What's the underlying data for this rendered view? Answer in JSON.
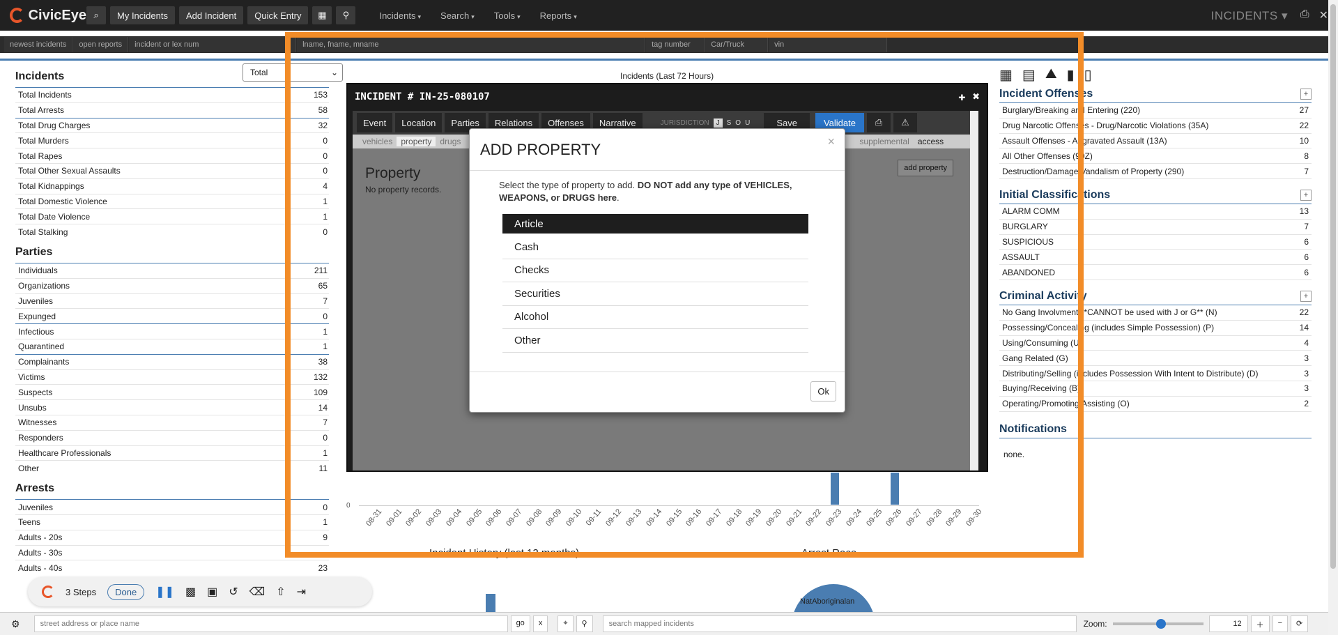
{
  "app": {
    "name": "CivicEye",
    "section_title": "INCIDENTS"
  },
  "topnav": {
    "buttons": [
      "My Incidents",
      "Add Incident",
      "Quick Entry"
    ],
    "menus": [
      "Incidents",
      "Search",
      "Tools",
      "Reports"
    ]
  },
  "subbar": {
    "fields": [
      "newest incidents",
      "open reports",
      "incident or lex num",
      "lname, fname, mname",
      "tag number",
      "Car/Truck",
      "vin"
    ]
  },
  "incidents": {
    "title": "Incidents",
    "filter": "Total",
    "rows": [
      [
        "Total Incidents",
        "153"
      ],
      [
        "Total Arrests",
        "58"
      ],
      [
        "Total Drug Charges",
        "32"
      ],
      [
        "Total Murders",
        "0"
      ],
      [
        "Total Rapes",
        "0"
      ],
      [
        "Total Other Sexual Assaults",
        "0"
      ],
      [
        "Total Kidnappings",
        "4"
      ],
      [
        "Total Domestic Violence",
        "1"
      ],
      [
        "Total Date Violence",
        "1"
      ],
      [
        "Total Stalking",
        "0"
      ]
    ]
  },
  "parties": {
    "title": "Parties",
    "rows": [
      [
        "Individuals",
        "211"
      ],
      [
        "Organizations",
        "65"
      ],
      [
        "Juveniles",
        "7"
      ],
      [
        "Expunged",
        "0"
      ],
      [
        "Infectious",
        "1"
      ],
      [
        "Quarantined",
        "1"
      ],
      [
        "Complainants",
        "38"
      ],
      [
        "Victims",
        "132"
      ],
      [
        "Suspects",
        "109"
      ],
      [
        "Unsubs",
        "14"
      ],
      [
        "Witnesses",
        "7"
      ],
      [
        "Responders",
        "0"
      ],
      [
        "Healthcare Professionals",
        "1"
      ],
      [
        "Other",
        "11"
      ]
    ]
  },
  "arrests": {
    "title": "Arrests",
    "rows": [
      [
        "Juveniles",
        "0"
      ],
      [
        "Teens",
        "1"
      ],
      [
        "Adults - 20s",
        "9"
      ],
      [
        "Adults - 30s",
        ""
      ],
      [
        "Adults - 40s",
        "23"
      ]
    ]
  },
  "chart": {
    "title": "Incidents (Last 72 Hours)",
    "zero": "0",
    "ticks": [
      "08-31",
      "09-01",
      "09-02",
      "09-03",
      "09-04",
      "09-05",
      "09-06",
      "09-07",
      "09-08",
      "09-09",
      "09-10",
      "09-11",
      "09-12",
      "09-13",
      "09-14",
      "09-15",
      "09-16",
      "09-17",
      "09-18",
      "09-19",
      "09-20",
      "09-21",
      "09-22",
      "09-23",
      "09-24",
      "09-25",
      "09-26",
      "09-27",
      "09-28",
      "09-29",
      "09-30"
    ]
  },
  "offenses": {
    "title": "Incident Offenses",
    "rows": [
      [
        "Burglary/Breaking and Entering (220)",
        "27"
      ],
      [
        "Drug Narcotic Offenses - Drug/Narcotic Violations (35A)",
        "22"
      ],
      [
        "Assault Offenses - Aggravated Assault (13A)",
        "10"
      ],
      [
        "All Other Offenses (90Z)",
        "8"
      ],
      [
        "Destruction/Damage/Vandalism of Property (290)",
        "7"
      ]
    ]
  },
  "classifications": {
    "title": "Initial Classifications",
    "rows": [
      [
        "ALARM COMM",
        "13"
      ],
      [
        "BURGLARY",
        "7"
      ],
      [
        "SUSPICIOUS",
        "6"
      ],
      [
        "ASSAULT",
        "6"
      ],
      [
        "ABANDONED",
        "6"
      ]
    ]
  },
  "criminal": {
    "title": "Criminal Activity",
    "rows": [
      [
        "No Gang Involvment **CANNOT be used with J or G** (N)",
        "22"
      ],
      [
        "Possessing/Concealing (includes Simple Possession) (P)",
        "14"
      ],
      [
        "Using/Consuming (U)",
        "4"
      ],
      [
        "Gang Related (G)",
        "3"
      ],
      [
        "Distributing/Selling (includes Possession With Intent to Distribute) (D)",
        "3"
      ],
      [
        "Buying/Receiving (B)",
        "3"
      ],
      [
        "Operating/Promoting/Assisting (O)",
        "2"
      ]
    ]
  },
  "notifications": {
    "title": "Notifications",
    "text": "none."
  },
  "incident_window": {
    "number": "INCIDENT # IN-25-080107",
    "tabs": [
      "Event",
      "Location",
      "Parties",
      "Relations",
      "Offenses",
      "Narrative"
    ],
    "jurisdiction_label": "JURISDICTION",
    "jurisdiction_opts": [
      "J",
      "S",
      "O",
      "U"
    ],
    "save": "Save",
    "validate": "Validate",
    "subtabs": [
      "vehicles",
      "property",
      "drugs",
      "supplemental",
      "access"
    ],
    "property_title": "Property",
    "property_none": "No property records.",
    "add_property": "add property"
  },
  "modal": {
    "title": "ADD PROPERTY",
    "desc_a": "Select the type of property to add. ",
    "desc_b": "DO NOT add any type of VEHICLES, WEAPONS, or DRUGS here",
    "desc_c": ".",
    "options": [
      "Article",
      "Cash",
      "Checks",
      "Securities",
      "Alcohol",
      "Other"
    ],
    "ok": "Ok"
  },
  "recorder": {
    "steps": "3 Steps",
    "done": "Done"
  },
  "lower": {
    "left_title": "Incident History (last 12 months)",
    "right_title": "Arrest Race",
    "pie_label": "NatAboriginalan"
  },
  "bottombar": {
    "address_placeholder": "street address or place name",
    "go": "go",
    "x": "x",
    "mapped_placeholder": "search mapped incidents",
    "zoom_label": "Zoom:",
    "zoom_value": "12"
  }
}
